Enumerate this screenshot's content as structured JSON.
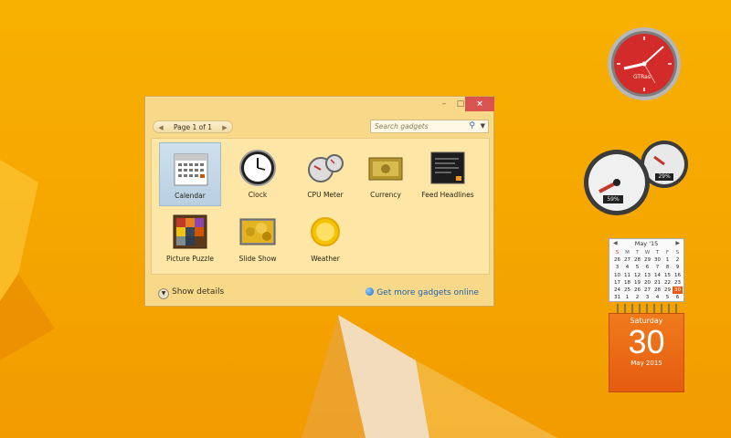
{
  "window": {
    "pager_label": "Page 1 of 1",
    "search_placeholder": "Search gadgets",
    "minimize_glyph": "–",
    "maximize_glyph": "□",
    "close_glyph": "×",
    "gadgets": [
      {
        "label": "Calendar",
        "icon": "calendar-icon",
        "selected": true
      },
      {
        "label": "Clock",
        "icon": "clock-icon",
        "selected": false
      },
      {
        "label": "CPU Meter",
        "icon": "cpu-meter-icon",
        "selected": false
      },
      {
        "label": "Currency",
        "icon": "currency-icon",
        "selected": false
      },
      {
        "label": "Feed Headlines",
        "icon": "feed-headlines-icon",
        "selected": false
      },
      {
        "label": "Picture Puzzle",
        "icon": "picture-puzzle-icon",
        "selected": false
      },
      {
        "label": "Slide Show",
        "icon": "slide-show-icon",
        "selected": false
      },
      {
        "label": "Weather",
        "icon": "weather-icon",
        "selected": false
      }
    ],
    "show_details": "Show details",
    "get_more": "Get more gadgets online"
  },
  "clock_gadget": {
    "brand": "GTRas"
  },
  "cpu_gadget": {
    "cpu_percent": "59%",
    "memory_percent": "29%"
  },
  "calendar_gadget": {
    "month_label": "May '15",
    "weekdays": [
      "S",
      "M",
      "T",
      "W",
      "T",
      "F",
      "S"
    ],
    "weeks": [
      [
        "26",
        "27",
        "28",
        "29",
        "30",
        "1",
        "2"
      ],
      [
        "3",
        "4",
        "5",
        "6",
        "7",
        "8",
        "9"
      ],
      [
        "10",
        "11",
        "12",
        "13",
        "14",
        "15",
        "16"
      ],
      [
        "17",
        "18",
        "19",
        "20",
        "21",
        "22",
        "23"
      ],
      [
        "24",
        "25",
        "26",
        "27",
        "28",
        "29",
        "30"
      ],
      [
        "31",
        "1",
        "2",
        "3",
        "4",
        "5",
        "6"
      ]
    ],
    "day_name": "Saturday",
    "day_number": "30",
    "month_year": "May 2015"
  },
  "colors": {
    "accent": "#f5a600",
    "close_red": "#d9534f",
    "link_blue": "#1b5fb0",
    "calendar_orange": "#e55c10"
  }
}
